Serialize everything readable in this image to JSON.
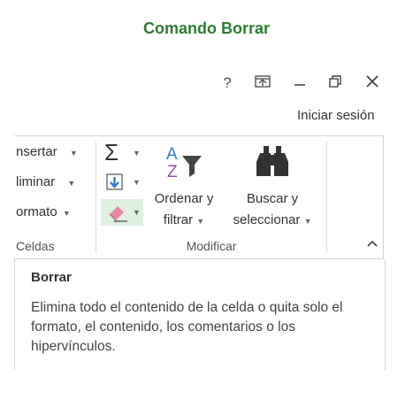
{
  "page": {
    "title": "Comando Borrar"
  },
  "window_controls": {
    "help": "?",
    "ribbon_display": "⊼",
    "minimize": "—",
    "restore": "⧉",
    "close": "✕"
  },
  "account": {
    "signin": "Iniciar sesión"
  },
  "cells_group": {
    "insert_label": "nsertar",
    "delete_label": "liminar",
    "format_label": "ormato",
    "group_label": "Celdas"
  },
  "modify_group": {
    "sort_line1": "Ordenar y",
    "sort_line2": "filtrar",
    "find_line1": "Buscar y",
    "find_line2": "seleccionar",
    "group_label": "Modificar"
  },
  "tooltip": {
    "title": "Borrar",
    "body": "Elimina todo el contenido de la celda o quita solo el formato, el contenido, los comentarios o los hipervínculos."
  },
  "colors": {
    "title_green": "#2e7d32",
    "highlight": "#dff0e1",
    "accent_blue": "#2b7bd6",
    "accent_purple": "#8a4fb8"
  },
  "icons": [
    "sigma-icon",
    "fill-down-icon",
    "eraser-icon",
    "sort-filter-icon",
    "binoculars-icon",
    "collapse-ribbon-icon"
  ]
}
